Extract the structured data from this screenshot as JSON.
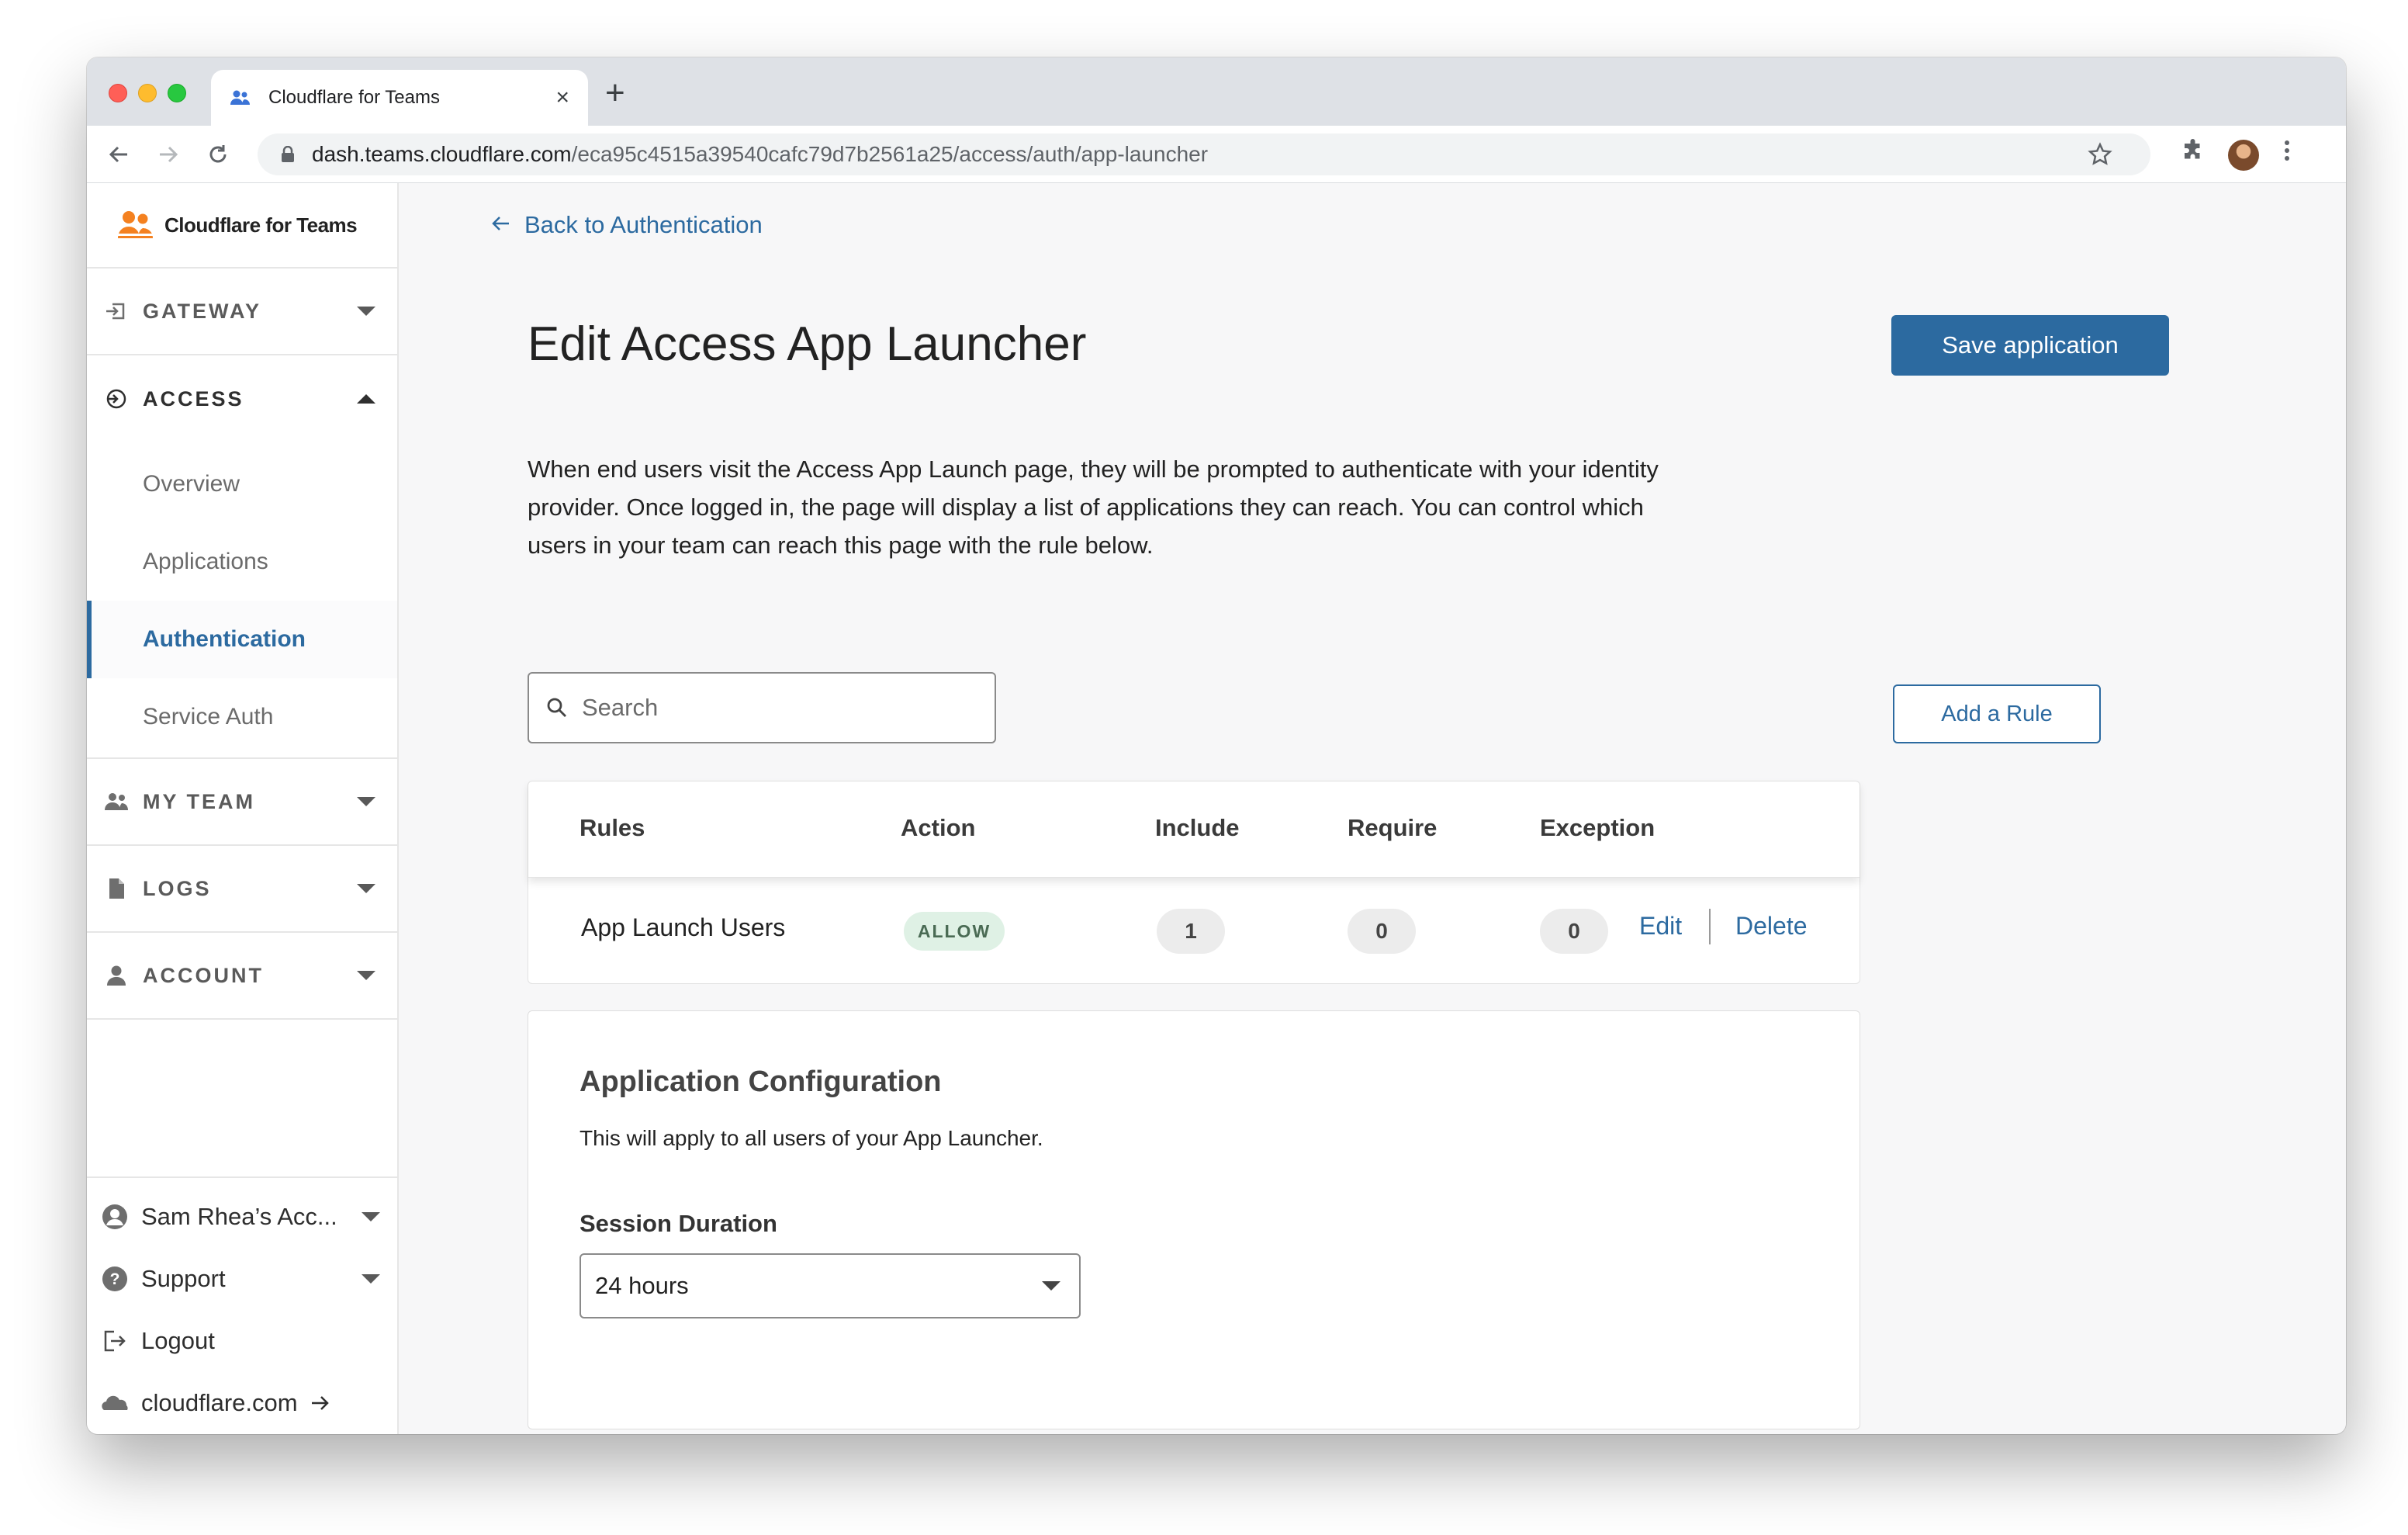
{
  "browser": {
    "tab_title": "Cloudflare for Teams",
    "new_tab": "+",
    "close_tab": "×",
    "url_host": "dash.teams.cloudflare.com",
    "url_path": "/eca95c4515a39540cafc79d7b2561a25/access/auth/app-launcher"
  },
  "sidebar": {
    "brand": "Cloudflare for Teams",
    "sections": {
      "gateway": "GATEWAY",
      "access": "ACCESS",
      "my_team": "MY TEAM",
      "logs": "LOGS",
      "account": "ACCOUNT"
    },
    "access_items": [
      "Overview",
      "Applications",
      "Authentication",
      "Service Auth"
    ],
    "active_item": "Authentication",
    "bottom": {
      "account_name": "Sam Rhea’s Acc...",
      "support": "Support",
      "logout": "Logout",
      "site_link": "cloudflare.com"
    }
  },
  "main": {
    "back_link": "Back to Authentication",
    "title": "Edit Access App Launcher",
    "save_button": "Save application",
    "description": "When end users visit the Access App Launch page, they will be prompted to authenticate with your identity provider. Once logged in, the page will display a list of applications they can reach. You can control which users in your team can reach this page with the rule below.",
    "search_placeholder": "Search",
    "add_rule_button": "Add a Rule",
    "table": {
      "headers": [
        "Rules",
        "Action",
        "Include",
        "Require",
        "Exception"
      ],
      "rows": [
        {
          "rule": "App Launch Users",
          "action": "ALLOW",
          "include": "1",
          "require": "0",
          "exception": "0",
          "edit": "Edit",
          "delete": "Delete"
        }
      ]
    },
    "config": {
      "title": "Application Configuration",
      "subtitle": "This will apply to all users of your App Launcher.",
      "session_label": "Session Duration",
      "session_value": "24 hours"
    }
  },
  "colors": {
    "accent": "#2c6aa0",
    "brand_orange": "#f48120",
    "allow_bg": "#dff1e5"
  }
}
